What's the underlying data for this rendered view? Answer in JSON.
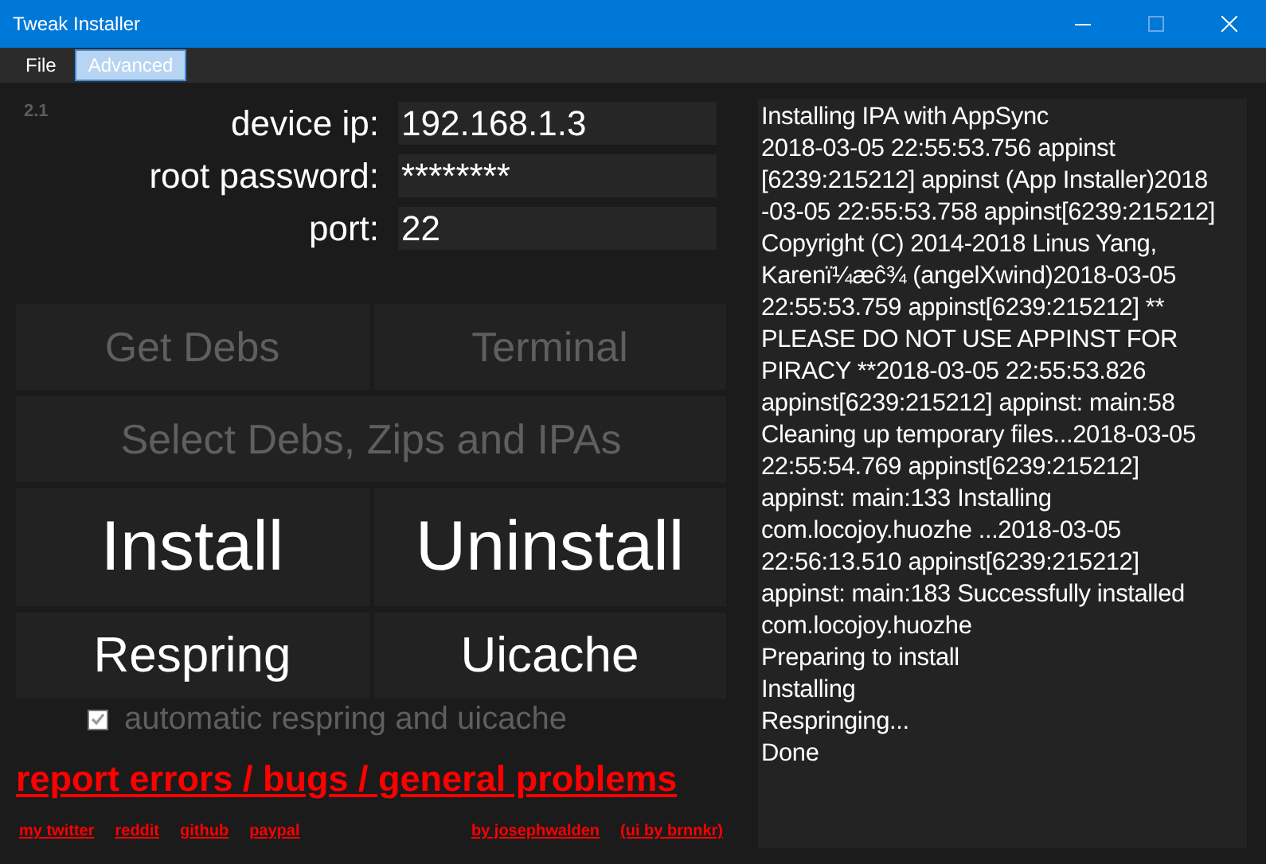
{
  "window": {
    "title": "Tweak Installer"
  },
  "menu": [
    {
      "label": "File",
      "selected": false
    },
    {
      "label": "Advanced",
      "selected": true
    }
  ],
  "version": "2.1",
  "fields": [
    {
      "label": "device ip:",
      "value": "192.168.1.3"
    },
    {
      "label": "root password:",
      "value": "********"
    },
    {
      "label": "port:",
      "value": "22"
    }
  ],
  "button_rows": [
    [
      {
        "label": "Get Debs",
        "disabled": true
      },
      {
        "label": "Terminal",
        "disabled": true
      }
    ],
    [
      {
        "label": "Select Debs, Zips and IPAs",
        "disabled": true
      }
    ],
    [
      {
        "label": "Install",
        "disabled": false
      },
      {
        "label": "Uninstall",
        "disabled": false
      }
    ],
    [
      {
        "label": "Respring",
        "disabled": false
      },
      {
        "label": "Uicache",
        "disabled": false
      }
    ]
  ],
  "auto_option": {
    "label": "automatic respring and uicache",
    "checked": true,
    "disabled": true
  },
  "report_link": "report errors / bugs / general problems",
  "links_left": [
    "my twitter",
    "reddit",
    "github",
    "paypal"
  ],
  "links_right": [
    "by josephwalden",
    "(ui by brnnkr)"
  ],
  "log": [
    "Installing IPA with AppSync",
    "2018-03-05 22:55:53.756 appinst",
    "[6239:215212] appinst (App Installer)2018",
    "-03-05 22:55:53.758 appinst[6239:215212]",
    "Copyright (C) 2014-2018 Linus Yang,",
    "Karenï¼æĉ¾ (angelXwind)2018-03-05",
    "22:55:53.759 appinst[6239:215212] **",
    "PLEASE DO NOT USE APPINST FOR",
    "PIRACY **2018-03-05 22:55:53.826",
    "appinst[6239:215212] appinst: main:58",
    "Cleaning up temporary files...2018-03-05",
    "22:55:54.769 appinst[6239:215212]",
    "appinst: main:133 Installing",
    "com.locojoy.huozhe ...2018-03-05",
    "22:56:13.510 appinst[6239:215212]",
    "appinst: main:183 Successfully installed",
    "com.locojoy.huozhe",
    "Preparing to install",
    "Installing",
    "Respringing...",
    "Done"
  ]
}
